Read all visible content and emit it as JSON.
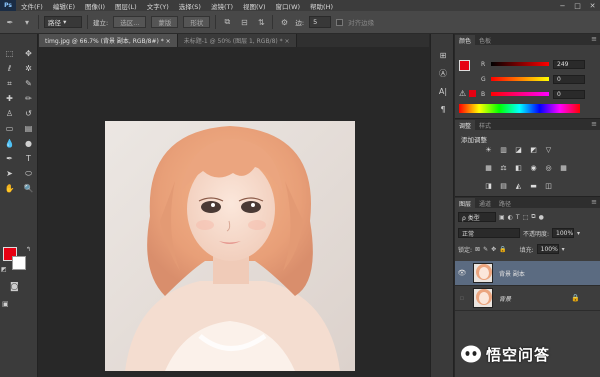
{
  "menu": {
    "logo": "Ps",
    "items": [
      "文件(F)",
      "编辑(E)",
      "图像(I)",
      "图层(L)",
      "文字(Y)",
      "选择(S)",
      "滤镜(T)",
      "视图(V)",
      "窗口(W)",
      "帮助(H)"
    ],
    "window_controls": [
      "−",
      "□",
      "✕"
    ]
  },
  "options": {
    "tool_mode": "路径",
    "build_label": "建立:",
    "selection_btn": "选区...",
    "mask_btn": "蒙版",
    "shape_btn": "形状",
    "edge_label": "边:",
    "edge_value": "5",
    "align_edges_label": "对齐边缘"
  },
  "tabs": [
    {
      "label": "timg.jpg @ 66.7% (背景 副本, RGB/8#) * ×"
    },
    {
      "label": "未标题-1 @ 50% (图层 1, RGB/8) * ×"
    }
  ],
  "color_panel": {
    "tabs": [
      "颜色",
      "色板"
    ],
    "channels": [
      {
        "label": "R",
        "value": "249"
      },
      {
        "label": "G",
        "value": "0"
      },
      {
        "label": "B",
        "value": "0"
      }
    ],
    "foreground_color": "#e60012"
  },
  "adjust_panel": {
    "tabs": [
      "调整",
      "样式"
    ],
    "title": "添加调整"
  },
  "layers_panel": {
    "tabs": [
      "图层",
      "通道",
      "路径"
    ],
    "filter_label": "ρ 类型",
    "blend_mode": "正常",
    "opacity_label": "不透明度:",
    "opacity_value": "100%",
    "lock_label": "锁定:",
    "fill_label": "填充:",
    "fill_value": "100%",
    "layers": [
      {
        "name": "背景 副本",
        "selected": true
      },
      {
        "name": "背景",
        "selected": false
      }
    ]
  },
  "watermark": {
    "text": "悟空问答"
  }
}
